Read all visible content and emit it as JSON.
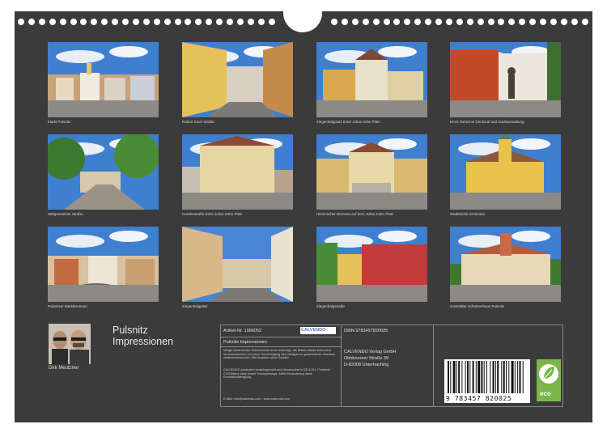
{
  "calendar": {
    "title_line1": "Pulsnitz",
    "title_line2": "Impressionen",
    "author": "Dirk Meutzner"
  },
  "photos": [
    {
      "caption": "Markt Pulsnitz",
      "scene": "square"
    },
    {
      "caption": "Robert Koch Straße",
      "scene": "street"
    },
    {
      "caption": "Ziegenbalgplatz Ecke Julius Kühn Platz",
      "scene": "corner"
    },
    {
      "caption": "Ernst Rietschel Denkmal und Stadtverwaltung",
      "scene": "monument"
    },
    {
      "caption": "Wittgensteiner Straße",
      "scene": "trees"
    },
    {
      "caption": "Goethestraße Ecke Julius Kühn Platz",
      "scene": "tallhouse"
    },
    {
      "caption": "Historischer Brunnen auf dem Julius Kühn Platz",
      "scene": "fountain"
    },
    {
      "caption": "Stadtkirche St.Nicolai",
      "scene": "church"
    },
    {
      "caption": "Pulsnitzer Marktbrunnen",
      "scene": "market"
    },
    {
      "caption": "Ziegenbalgplatz",
      "scene": "lane"
    },
    {
      "caption": "Ziegenbalgstraße",
      "scene": "redhouse"
    },
    {
      "caption": "Gaststätte Schützenhaus Pulsnitz",
      "scene": "hall"
    }
  ],
  "info": {
    "article_label": "Artikel-Nr. 1996052",
    "publisher_logo": "CALVENDO",
    "product_title": "Pulsnitz Impressionen",
    "legal_text": "Infolge bestehender Schutzrechte ist es untersagt, die Blätter dieses Kalenders herauszutrennen und ohne Genehmigung des Verlages zu gewerblichen Zwecken weiterzuverwenden. Alle Angaben ohne Gewähr.",
    "production_text": "CALVENDO produziert bedarfsgerecht und klimaneutral in DE & EU. Postivere CO2-Bilanz dank kurzer Transportwege. AMW-Reduzierung dank Einzelstückfertigung.",
    "contact": "E-Mail: info@calvendo.com • www.calvendo.com",
    "isbn": "ISBN 9783457820025",
    "publisher_line1": "CALVENDO Verlag GmbH",
    "publisher_line2": "Ottobrunner Straße 39",
    "publisher_line3": "D-82008 Unterhaching",
    "barcode_digits": "9 783457 820025",
    "eco_label": "eco"
  },
  "colors": {
    "background": "#3b3b3b",
    "sky": "#3f7fd0",
    "eco_green": "#7ab648"
  }
}
